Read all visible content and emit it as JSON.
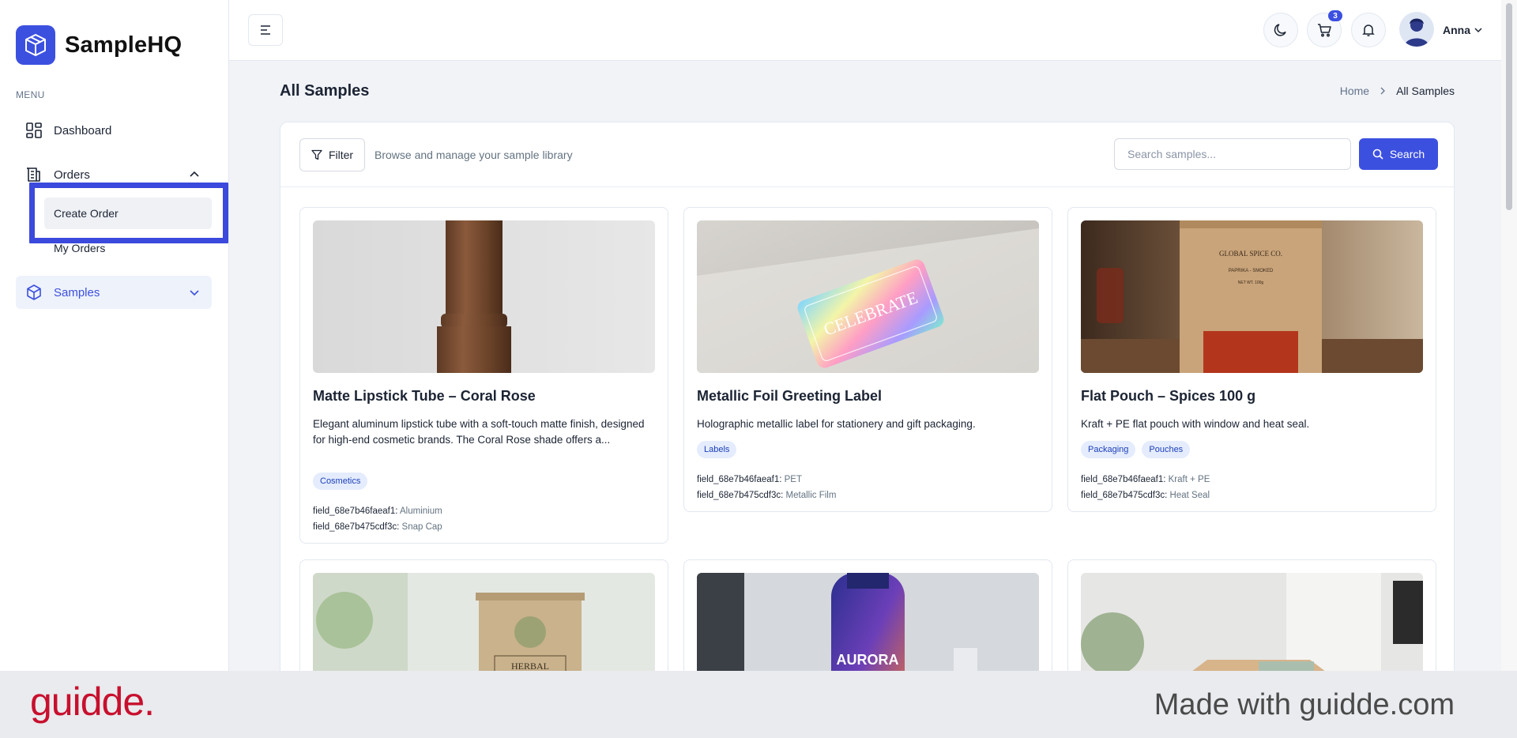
{
  "brand": {
    "name": "SampleHQ"
  },
  "sidebar": {
    "menu_label": "MENU",
    "items": [
      {
        "label": "Dashboard",
        "icon": "dashboard-icon"
      },
      {
        "label": "Orders",
        "icon": "orders-icon",
        "expanded": true,
        "children": [
          {
            "label": "Create Order",
            "active": true
          },
          {
            "label": "My Orders"
          }
        ]
      },
      {
        "label": "Samples",
        "icon": "box-icon",
        "active": true
      }
    ]
  },
  "header": {
    "cart_count": "3",
    "user_name": "Anna",
    "icons": [
      "menu-icon",
      "moon-icon",
      "cart-icon",
      "bell-icon",
      "avatar",
      "chevron-down-icon"
    ]
  },
  "page": {
    "title": "All Samples",
    "breadcrumb": {
      "home": "Home",
      "current": "All Samples"
    }
  },
  "toolbar": {
    "filter_label": "Filter",
    "description": "Browse and manage your sample library",
    "search_placeholder": "Search samples...",
    "search_label": "Search"
  },
  "cards": [
    {
      "title": "Matte Lipstick Tube – Coral Rose",
      "description": "Elegant aluminum lipstick tube with a soft-touch matte finish, designed for high-end cosmetic brands. The Coral Rose shade offers a...",
      "tags": [
        "Cosmetics"
      ],
      "fields": [
        {
          "key": "field_68e7b46faeaf1:",
          "value": "Aluminium"
        },
        {
          "key": "field_68e7b475cdf3c:",
          "value": "Snap Cap"
        }
      ]
    },
    {
      "title": "Metallic Foil Greeting Label",
      "description": "Holographic metallic label for stationery and gift packaging.",
      "tags": [
        "Labels"
      ],
      "image_text": "CELEBRATE",
      "fields": [
        {
          "key": "field_68e7b46faeaf1:",
          "value": "PET"
        },
        {
          "key": "field_68e7b475cdf3c:",
          "value": "Metallic Film"
        }
      ]
    },
    {
      "title": "Flat Pouch – Spices 100 g",
      "description": "Kraft + PE flat pouch with window and heat seal.",
      "tags": [
        "Packaging",
        "Pouches"
      ],
      "image_text": [
        "GLOBAL SPICE CO.",
        "PAPRIKA - SMOKED",
        "NET WT. 100g"
      ],
      "fields": [
        {
          "key": "field_68e7b46faeaf1:",
          "value": "Kraft + PE"
        },
        {
          "key": "field_68e7b475cdf3c:",
          "value": "Heat Seal"
        }
      ]
    },
    {
      "image_text": "HERBAL"
    },
    {
      "image_text": "AURORA"
    },
    {}
  ],
  "footer": {
    "logo": "guidde.",
    "text": "Made with guidde.com"
  },
  "colors": {
    "accent": "#3c50e0",
    "highlight": "#3b49dc",
    "footer_logo": "#c8102e"
  }
}
